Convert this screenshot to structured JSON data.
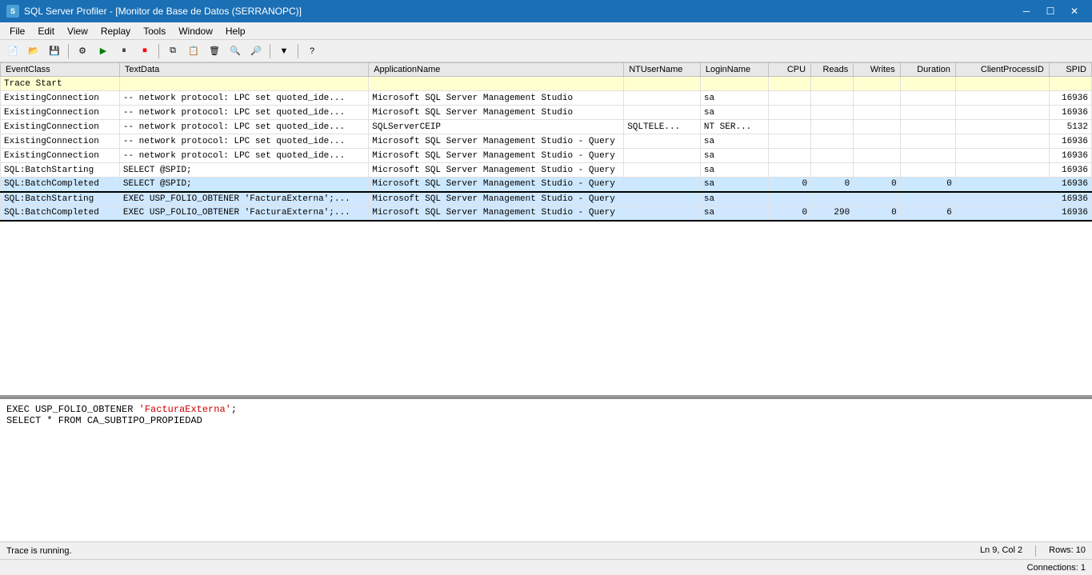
{
  "titleBar": {
    "title": "SQL Server Profiler - [Monitor de Base de Datos (SERRANOPC)]",
    "icon": "SQL",
    "minimize": "🗕",
    "maximize": "🗖",
    "close": "✕",
    "inner_minimize": "─",
    "inner_maximize": "□",
    "inner_close": "✕"
  },
  "menuBar": {
    "items": [
      "File",
      "Edit",
      "View",
      "Replay",
      "Tools",
      "Window",
      "Help"
    ]
  },
  "toolbar": {
    "buttons": [
      "new",
      "open",
      "save",
      "sep",
      "props",
      "start",
      "pause",
      "stop",
      "sep",
      "copy",
      "paste",
      "clear",
      "search",
      "find",
      "sep",
      "filter",
      "sep",
      "help"
    ]
  },
  "traceGrid": {
    "columns": [
      "EventClass",
      "TextData",
      "ApplicationName",
      "NTUserName",
      "LoginName",
      "CPU",
      "Reads",
      "Writes",
      "Duration",
      "ClientProcessID",
      "SPID"
    ],
    "rows": [
      {
        "id": 0,
        "eventClass": "Trace Start",
        "textData": "",
        "appName": "",
        "ntUser": "",
        "login": "",
        "cpu": "",
        "reads": "",
        "writes": "",
        "duration": "",
        "clientPid": "",
        "spid": "",
        "type": "trace-start"
      },
      {
        "id": 1,
        "eventClass": "ExistingConnection",
        "textData": "-- network protocol: LPC  set quoted_ide...",
        "appName": "Microsoft SQL Server Management Studio",
        "ntUser": "",
        "login": "sa",
        "cpu": "",
        "reads": "",
        "writes": "",
        "duration": "",
        "clientPid": "",
        "spid": "16936",
        "type": "normal"
      },
      {
        "id": 2,
        "eventClass": "ExistingConnection",
        "textData": "-- network protocol: LPC  set quoted_ide...",
        "appName": "Microsoft SQL Server Management Studio",
        "ntUser": "",
        "login": "sa",
        "cpu": "",
        "reads": "",
        "writes": "",
        "duration": "",
        "clientPid": "",
        "spid": "16936",
        "type": "normal"
      },
      {
        "id": 3,
        "eventClass": "ExistingConnection",
        "textData": "-- network protocol: LPC  set quoted_ide...",
        "appName": "SQLServerCEIP",
        "ntUser": "SQLTELE...",
        "login": "NT SER...",
        "cpu": "",
        "reads": "",
        "writes": "",
        "duration": "",
        "clientPid": "",
        "spid": "5132",
        "type": "normal"
      },
      {
        "id": 4,
        "eventClass": "ExistingConnection",
        "textData": "-- network protocol: LPC  set quoted_ide...",
        "appName": "Microsoft SQL Server Management Studio - Query",
        "ntUser": "",
        "login": "sa",
        "cpu": "",
        "reads": "",
        "writes": "",
        "duration": "",
        "clientPid": "",
        "spid": "16936",
        "type": "normal"
      },
      {
        "id": 5,
        "eventClass": "ExistingConnection",
        "textData": "-- network protocol: LPC  set quoted_ide...",
        "appName": "Microsoft SQL Server Management Studio - Query",
        "ntUser": "",
        "login": "sa",
        "cpu": "",
        "reads": "",
        "writes": "",
        "duration": "",
        "clientPid": "",
        "spid": "16936",
        "type": "normal"
      },
      {
        "id": 6,
        "eventClass": "SQL:BatchStarting",
        "textData": "SELECT @SPID;",
        "appName": "Microsoft SQL Server Management Studio - Query",
        "ntUser": "",
        "login": "sa",
        "cpu": "",
        "reads": "",
        "writes": "",
        "duration": "",
        "clientPid": "",
        "spid": "16936",
        "type": "normal"
      },
      {
        "id": 7,
        "eventClass": "SQL:BatchCompleted",
        "textData": "SELECT @SPID;",
        "appName": "Microsoft SQL Server Management Studio - Query",
        "ntUser": "",
        "login": "sa",
        "cpu": "0",
        "reads": "0",
        "writes": "0",
        "duration": "0",
        "clientPid": "",
        "spid": "16936",
        "type": "highlighted"
      },
      {
        "id": 8,
        "eventClass": "SQL:BatchStarting",
        "textData": "EXEC USP_FOLIO_OBTENER 'FacturaExterna';...",
        "appName": "Microsoft SQL Server Management Studio - Query",
        "ntUser": "",
        "login": "sa",
        "cpu": "",
        "reads": "",
        "writes": "",
        "duration": "",
        "clientPid": "",
        "spid": "16936",
        "type": "selected-start"
      },
      {
        "id": 9,
        "eventClass": "SQL:BatchCompleted",
        "textData": "EXEC USP_FOLIO_OBTENER 'FacturaExterna';...",
        "appName": "Microsoft SQL Server Management Studio - Query",
        "ntUser": "",
        "login": "sa",
        "cpu": "0",
        "reads": "290",
        "writes": "0",
        "duration": "6",
        "clientPid": "",
        "spid": "16936",
        "type": "selected-end"
      }
    ]
  },
  "sqlPreview": {
    "line1_black": "EXEC USP_FOLIO_OBTENER ",
    "line1_red": "'FacturaExterna'",
    "line1_end": ";",
    "line2_black": "SELECT * FROM CA_SUBTIPO_PROPIEDAD"
  },
  "statusBar": {
    "left": "Trace is running.",
    "position": "Ln 9, Col 2",
    "rows": "Rows: 10",
    "connections": "Connections: 1"
  },
  "columnLabels": {
    "eventClass": "EventClass",
    "textData": "TextData",
    "appName": "ApplicationName",
    "ntUser": "NTUserName",
    "login": "LoginName",
    "cpu": "CPU",
    "reads": "Reads",
    "writes": "Writes",
    "duration": "Duration",
    "clientPid": "ClientProcessID",
    "spid": "SPID"
  }
}
